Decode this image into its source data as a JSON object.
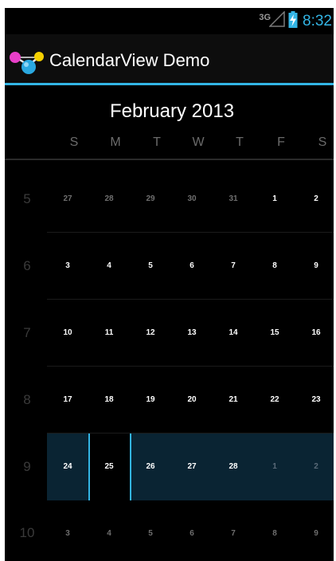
{
  "status_bar": {
    "network_type": "3G",
    "signal_icon": "signal-icon",
    "battery_icon": "battery-charging-icon",
    "time": "8:32",
    "accent_color": "#33b5e5"
  },
  "action_bar": {
    "app_icon": "molecule-app-icon",
    "title": "CalendarView Demo",
    "divider_color": "#33b5e5"
  },
  "calendar": {
    "month_title": "February 2013",
    "weekdays": [
      "S",
      "M",
      "T",
      "W",
      "T",
      "F",
      "S"
    ],
    "weeks": [
      {
        "number": "5",
        "days": [
          "27",
          "28",
          "29",
          "30",
          "31",
          "1",
          "2"
        ]
      },
      {
        "number": "6",
        "days": [
          "3",
          "4",
          "5",
          "6",
          "7",
          "8",
          "9"
        ]
      },
      {
        "number": "7",
        "days": [
          "10",
          "11",
          "12",
          "13",
          "14",
          "15",
          "16"
        ]
      },
      {
        "number": "8",
        "days": [
          "17",
          "18",
          "19",
          "20",
          "21",
          "22",
          "23"
        ]
      },
      {
        "number": "9",
        "days": [
          "24",
          "25",
          "26",
          "27",
          "28",
          "1",
          "2"
        ]
      },
      {
        "number": "10",
        "days": [
          "3",
          "4",
          "5",
          "6",
          "7",
          "8",
          "9"
        ]
      }
    ],
    "selected_date": "25",
    "selection_color": "#0a2433"
  }
}
